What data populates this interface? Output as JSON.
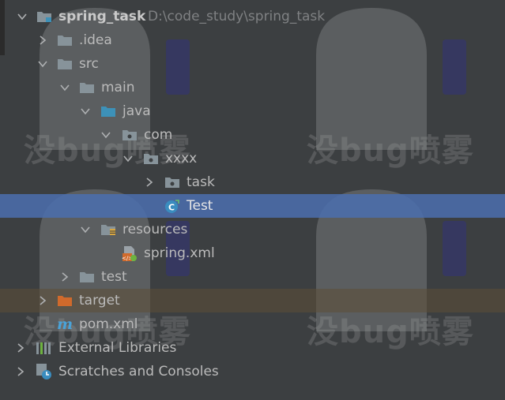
{
  "watermark": "没bug喷雾",
  "tree": {
    "root": {
      "label": "spring_task",
      "path": "D:\\code_study\\spring_task"
    },
    "idea": "idea",
    "idea_dot": ".",
    "src": "src",
    "main": "main",
    "java": "java",
    "com": "com",
    "xxxx": "xxxx",
    "task": "task",
    "test_class": "Test",
    "resources": "resources",
    "spring_xml": "spring.xml",
    "test_dir": "test",
    "target": "target",
    "pom": "pom.xml",
    "external_libraries": "External Libraries",
    "scratches": "Scratches and Consoles"
  },
  "colors": {
    "background": "#3c3f41",
    "selection": "#4b6eaf",
    "excluded_row": "#5c4f37",
    "folder": "#87939a",
    "source_folder": "#3d91b8",
    "excluded_folder": "#d06a2c"
  }
}
